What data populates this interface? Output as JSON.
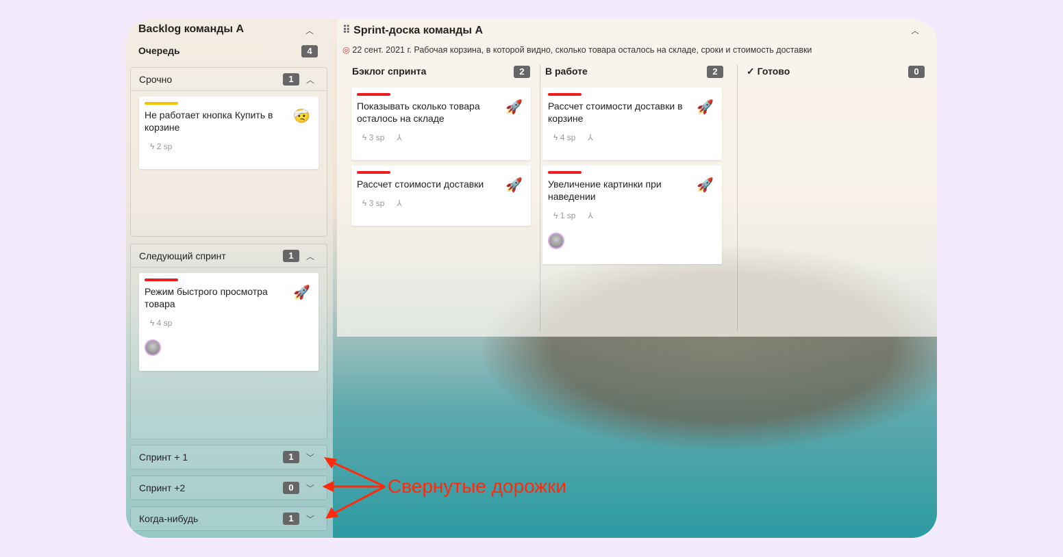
{
  "backlog": {
    "title": "Backlog команды А",
    "queue_label": "Очередь",
    "queue_count": "4",
    "lanes": [
      {
        "label": "Срочно",
        "count": "1",
        "cards": [
          {
            "title": "Не работает кнопка Купить в корзине",
            "sp": "2 sp",
            "bar_color": "#f5c400",
            "emoji": "🤕"
          }
        ]
      },
      {
        "label": "Следующий спринт",
        "count": "1",
        "cards": [
          {
            "title": "Режим быстрого просмотра товара",
            "sp": "4 sp",
            "bar_color": "#ee1c1c",
            "emoji": "🚀"
          }
        ]
      },
      {
        "label": "Спринт + 1",
        "count": "1"
      },
      {
        "label": "Спринт +2",
        "count": "0"
      },
      {
        "label": "Когда-нибудь",
        "count": "1"
      }
    ]
  },
  "board": {
    "title": "Sprint-доска команды А",
    "description": "22 сент. 2021 г. Рабочая корзина, в которой видно, сколько товара осталось на складе, сроки и стоимость доставки",
    "columns": [
      {
        "label": "Бэклог спринта",
        "count": "2",
        "cards": [
          {
            "title": "Показывать сколько товара осталось на складе",
            "sp": "3 sp"
          },
          {
            "title": "Рассчет стоимости доставки",
            "sp": "3 sp"
          }
        ]
      },
      {
        "label": "В работе",
        "count": "2",
        "cards": [
          {
            "title": "Рассчет стоимости доставки в корзине",
            "sp": "4 sp"
          },
          {
            "title": "Увеличение картинки при наведении",
            "sp": "1 sp"
          }
        ]
      },
      {
        "label": "Готово",
        "count": "0"
      }
    ]
  },
  "annotation": "Свернутые дорожки",
  "colors": {
    "priority_high": "#ee1c1c",
    "priority_medium": "#f5c400",
    "annotation": "#ff2a0a"
  }
}
